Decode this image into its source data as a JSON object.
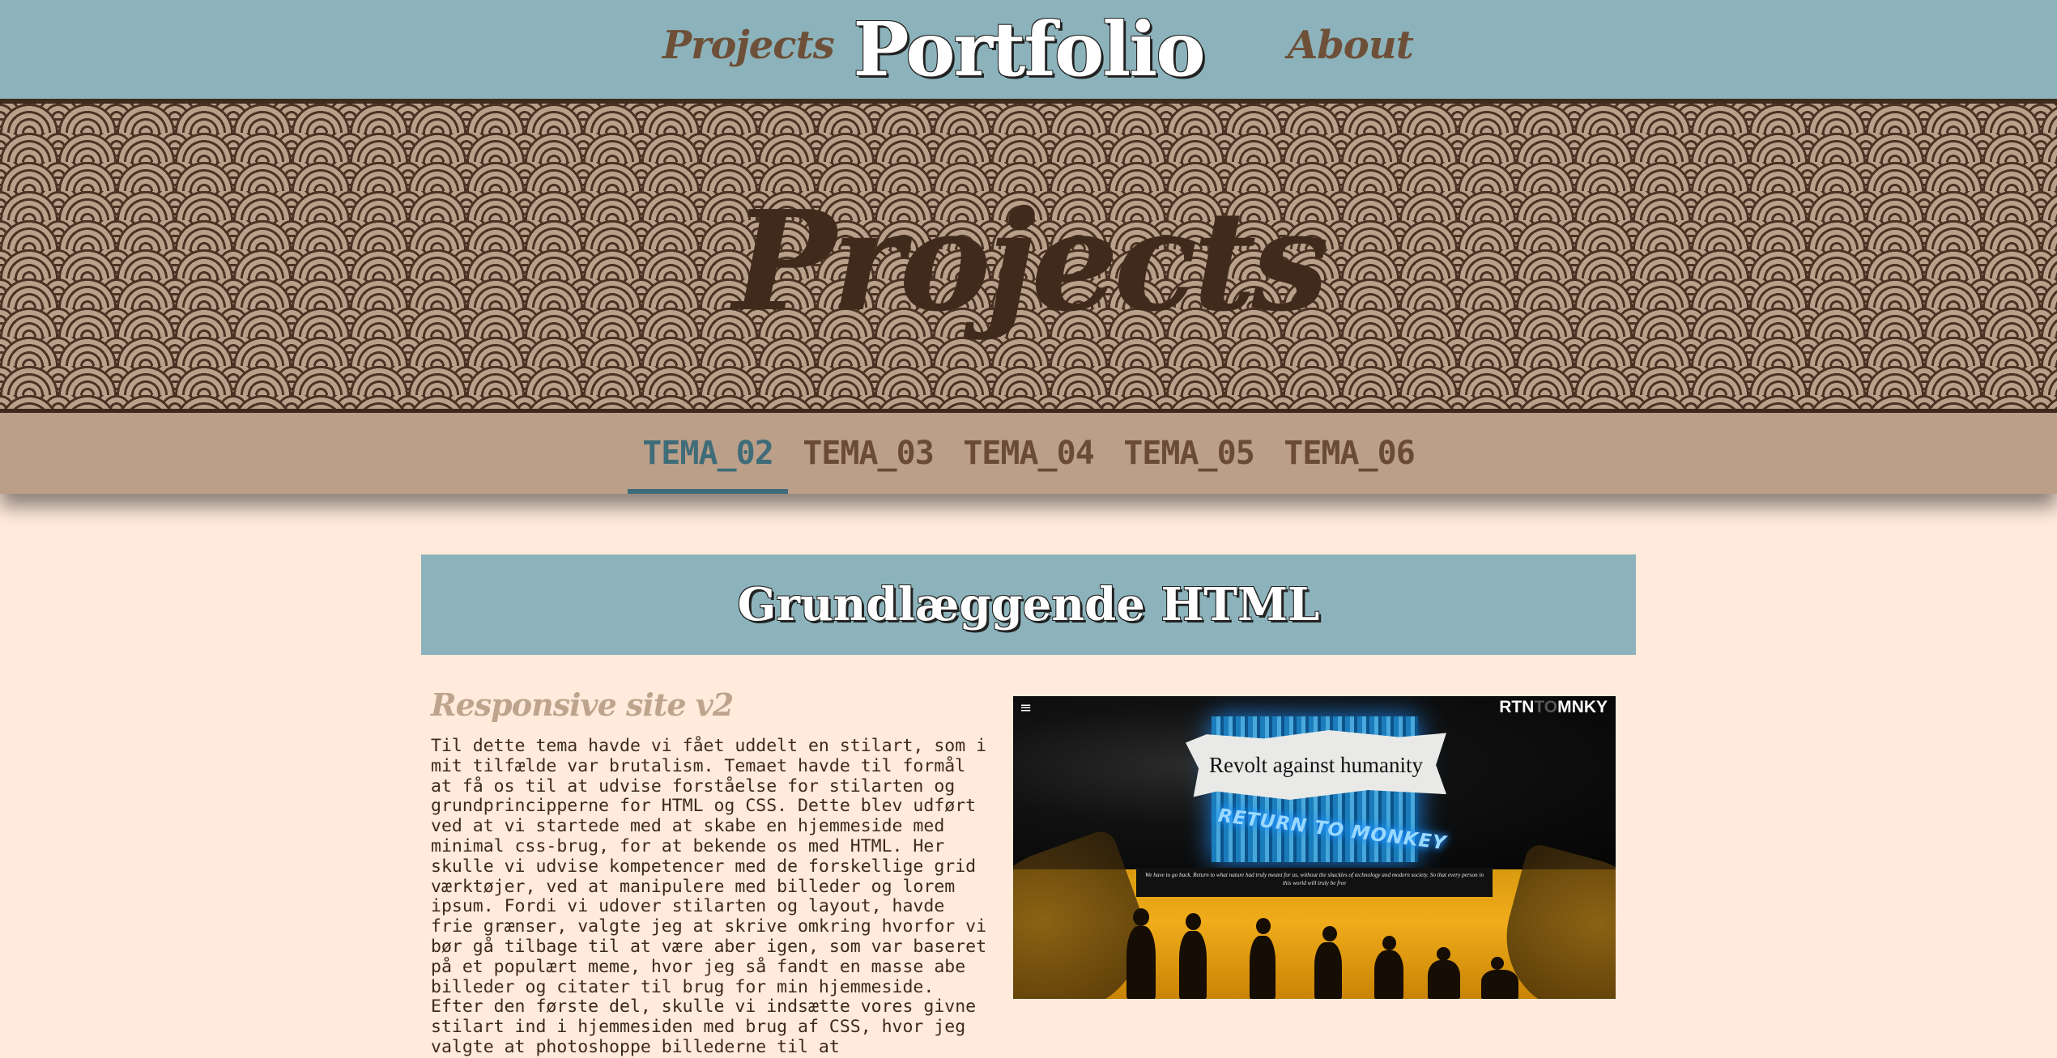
{
  "nav": {
    "projects": "Projects",
    "brand": "Portfolio",
    "about": "About"
  },
  "hero": {
    "title": "Projects"
  },
  "tabs": [
    {
      "label": "TEMA_02",
      "active": true
    },
    {
      "label": "TEMA_03",
      "active": false
    },
    {
      "label": "TEMA_04",
      "active": false
    },
    {
      "label": "TEMA_05",
      "active": false
    },
    {
      "label": "TEMA_06",
      "active": false
    }
  ],
  "section": {
    "title": "Grundlæggende HTML"
  },
  "project": {
    "heading": "Responsive site v2",
    "text": "Til dette tema havde vi fået uddelt en stilart, som i mit tilfælde var brutalism. Temaet havde til formål at få os til at udvise forståelse for stilarten og grundprincipperne for HTML og CSS. Dette blev udført ved at vi startede med at skabe en hjemmeside med minimal css-brug, for at bekende os med HTML. Her skulle vi udvise kompetencer med de forskellige grid værktøjer, ved at manipulere med billeder og lorem ipsum. Fordi vi udover stilarten og layout, havde frie grænser, valgte jeg at skrive omkring hvorfor vi bør gå tilbage til at være aber igen, som var baseret på et populært meme, hvor jeg så fandt en masse abe billeder og citater til brug for min hjemmeside. Efter den første del, skulle vi indsætte vores givne stilart ind i hjemmesiden med brug af CSS, hvor jeg valgte at photoshoppe billederne til at"
  },
  "preview": {
    "menu_icon": "≡",
    "logo_a": "RTN",
    "logo_b": "TO",
    "logo_c": "MNKY",
    "paper_title": "Revolt against humanity",
    "neon_text": "RETURN TO MONKEY",
    "quote": "We have to go back. Return to what nature had truly meant for us, without the shackles of technology and modern society. So that every person in this world will truly be free"
  },
  "colors": {
    "nav_bg": "#8cb3bb",
    "hero_bg": "#b9a08b",
    "dark_brown": "#3f2a1c",
    "tab_bg": "#bb9f89",
    "tab_active": "#3f6c79",
    "page_bg": "#ffeadb"
  }
}
